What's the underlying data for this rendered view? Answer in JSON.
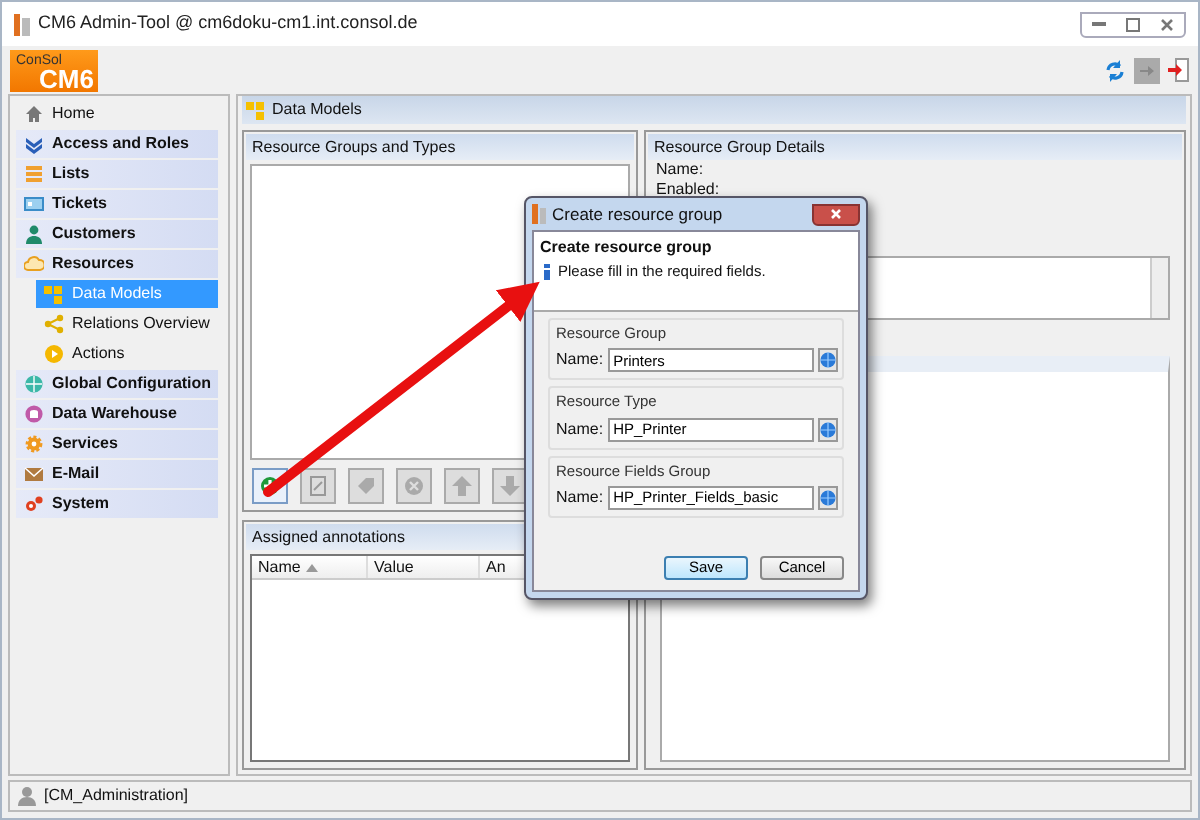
{
  "window": {
    "title": "CM6 Admin-Tool @ cm6doku-cm1.int.consol.de"
  },
  "logo": {
    "top": "ConSol",
    "main": "CM6"
  },
  "sidebar": {
    "items": [
      {
        "label": "Home",
        "kind": "home",
        "selected": false
      },
      {
        "label": "Access and Roles",
        "kind": "category",
        "selected": false
      },
      {
        "label": "Lists",
        "kind": "category",
        "selected": false
      },
      {
        "label": "Tickets",
        "kind": "category",
        "selected": false
      },
      {
        "label": "Customers",
        "kind": "category",
        "selected": false
      },
      {
        "label": "Resources",
        "kind": "category",
        "selected": false,
        "children": [
          {
            "label": "Data Models",
            "selected": true
          },
          {
            "label": "Relations Overview",
            "selected": false
          },
          {
            "label": "Actions",
            "selected": false
          }
        ]
      },
      {
        "label": "Global Configuration",
        "kind": "category",
        "selected": false
      },
      {
        "label": "Data Warehouse",
        "kind": "category",
        "selected": false
      },
      {
        "label": "Services",
        "kind": "category",
        "selected": false
      },
      {
        "label": "E-Mail",
        "kind": "category",
        "selected": false
      },
      {
        "label": "System",
        "kind": "category",
        "selected": false
      }
    ]
  },
  "content": {
    "title": "Data Models"
  },
  "groups_panel": {
    "title": "Resource Groups and Types",
    "toolbar": [
      {
        "disabled": false
      },
      {
        "disabled": true
      },
      {
        "disabled": true
      },
      {
        "disabled": true
      },
      {
        "disabled": true
      },
      {
        "disabled": true
      }
    ]
  },
  "annotations": {
    "title": "Assigned annotations",
    "columns": [
      {
        "label": "Name",
        "sorted": true
      },
      {
        "label": "Value",
        "sorted": false
      },
      {
        "label": "An",
        "sorted": false
      }
    ]
  },
  "details": {
    "title": "Resource Group Details",
    "fields": [
      "Name:",
      "Enabled:"
    ]
  },
  "dialog": {
    "title": "Create resource group",
    "heading": "Create resource group",
    "info": "Please fill in the required fields.",
    "groups": [
      {
        "legend": "Resource Group",
        "label": "Name:",
        "value": "Printers"
      },
      {
        "legend": "Resource Type",
        "label": "Name:",
        "value": "HP_Printer"
      },
      {
        "legend": "Resource Fields Group",
        "label": "Name:",
        "value": "HP_Printer_Fields_basic"
      }
    ],
    "buttons": [
      {
        "label": "Save",
        "default": true
      },
      {
        "label": "Cancel",
        "default": false
      }
    ]
  },
  "status_bar": {
    "user": "[CM_Administration]"
  }
}
